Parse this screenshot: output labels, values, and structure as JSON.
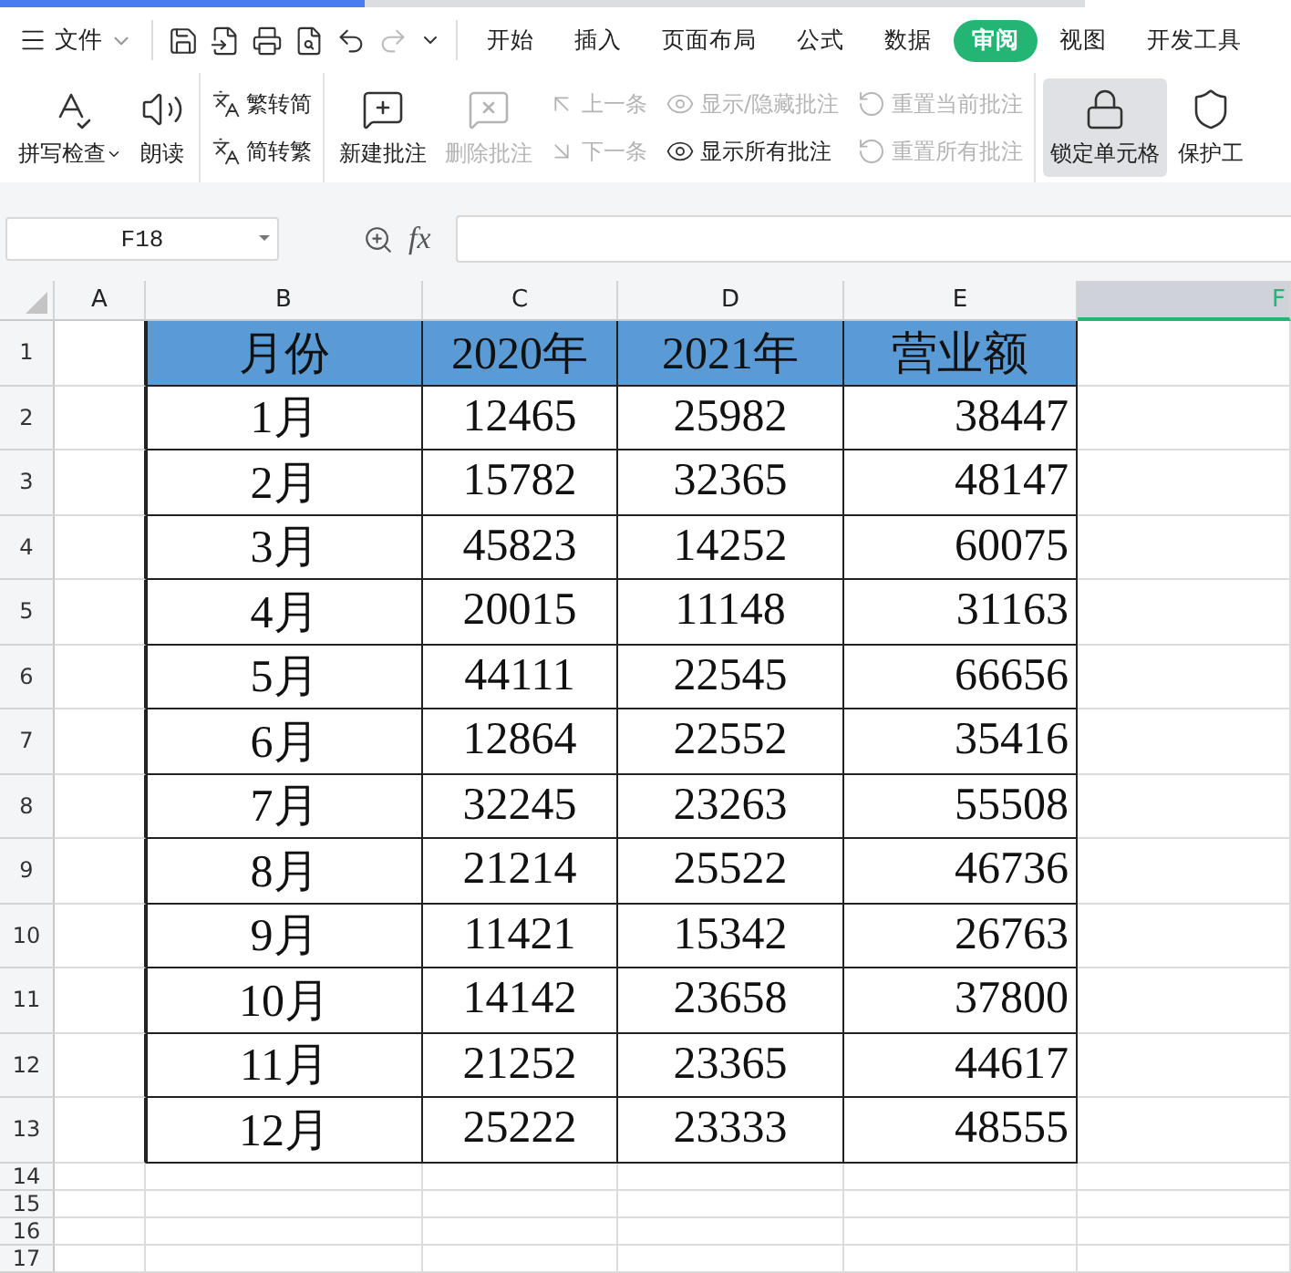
{
  "menu_bar": {
    "file_label": "文件",
    "tabs": [
      {
        "label": "开始",
        "selected": false
      },
      {
        "label": "插入",
        "selected": false
      },
      {
        "label": "页面布局",
        "selected": false
      },
      {
        "label": "公式",
        "selected": false
      },
      {
        "label": "数据",
        "selected": false
      },
      {
        "label": "审阅",
        "selected": true
      },
      {
        "label": "视图",
        "selected": false
      },
      {
        "label": "开发工具",
        "selected": false
      }
    ]
  },
  "ribbon": {
    "groups": [
      {
        "items": [
          {
            "kind": "large",
            "label": "拼写检查",
            "dropdown": true,
            "disabled": false,
            "highlighted": false
          },
          {
            "kind": "large",
            "label": "朗读",
            "disabled": false,
            "highlighted": false
          }
        ]
      },
      {
        "items": [
          {
            "kind": "small",
            "label": "繁转简",
            "disabled": false,
            "highlighted": false
          },
          {
            "kind": "small",
            "label": "简转繁",
            "disabled": false,
            "highlighted": false
          }
        ]
      },
      {
        "items": [
          {
            "kind": "large",
            "label": "新建批注",
            "disabled": false,
            "highlighted": false
          },
          {
            "kind": "large",
            "label": "删除批注",
            "disabled": true,
            "highlighted": false
          },
          {
            "kind": "small",
            "label": "上一条",
            "disabled": true,
            "highlighted": false
          },
          {
            "kind": "small",
            "label": "下一条",
            "disabled": true,
            "highlighted": false
          },
          {
            "kind": "small",
            "label": "显示/隐藏批注",
            "disabled": true,
            "highlighted": false
          },
          {
            "kind": "small",
            "label": "显示所有批注",
            "disabled": false,
            "highlighted": false
          },
          {
            "kind": "small",
            "label": "重置当前批注",
            "disabled": true,
            "highlighted": false
          },
          {
            "kind": "small",
            "label": "重置所有批注",
            "disabled": true,
            "highlighted": false
          }
        ]
      },
      {
        "items": [
          {
            "kind": "large",
            "label": "锁定单元格",
            "disabled": false,
            "highlighted": true
          },
          {
            "kind": "large",
            "label": "保护工",
            "disabled": false,
            "highlighted": false
          }
        ]
      }
    ]
  },
  "formula_bar": {
    "name_box": "F18",
    "function_label": "fx"
  },
  "sheet": {
    "columns": [
      {
        "label": "A",
        "selected": false
      },
      {
        "label": "B",
        "selected": false
      },
      {
        "label": "C",
        "selected": false
      },
      {
        "label": "D",
        "selected": false
      },
      {
        "label": "E",
        "selected": false
      },
      {
        "label": "F",
        "selected": true
      }
    ],
    "rows": [
      {
        "number": "1",
        "kind": "header",
        "cells": [
          "",
          "月份",
          "2020年",
          "2021年",
          "营业额"
        ]
      },
      {
        "number": "2",
        "kind": "data",
        "cells": [
          "",
          "1月",
          "12465",
          "25982",
          "38447"
        ]
      },
      {
        "number": "3",
        "kind": "data",
        "cells": [
          "",
          "2月",
          "15782",
          "32365",
          "48147"
        ]
      },
      {
        "number": "4",
        "kind": "data",
        "cells": [
          "",
          "3月",
          "45823",
          "14252",
          "60075"
        ]
      },
      {
        "number": "5",
        "kind": "data",
        "cells": [
          "",
          "4月",
          "20015",
          "11148",
          "31163"
        ]
      },
      {
        "number": "6",
        "kind": "data",
        "cells": [
          "",
          "5月",
          "44111",
          "22545",
          "66656"
        ]
      },
      {
        "number": "7",
        "kind": "data",
        "cells": [
          "",
          "6月",
          "12864",
          "22552",
          "35416"
        ]
      },
      {
        "number": "8",
        "kind": "data",
        "cells": [
          "",
          "7月",
          "32245",
          "23263",
          "55508"
        ]
      },
      {
        "number": "9",
        "kind": "data",
        "cells": [
          "",
          "8月",
          "21214",
          "25522",
          "46736"
        ]
      },
      {
        "number": "10",
        "kind": "data",
        "cells": [
          "",
          "9月",
          "11421",
          "15342",
          "26763"
        ]
      },
      {
        "number": "11",
        "kind": "data",
        "cells": [
          "",
          "10月",
          "14142",
          "23658",
          "37800"
        ]
      },
      {
        "number": "12",
        "kind": "data",
        "cells": [
          "",
          "11月",
          "21252",
          "23365",
          "44617"
        ]
      },
      {
        "number": "13",
        "kind": "data",
        "cells": [
          "",
          "12月",
          "25222",
          "23333",
          "48555"
        ]
      },
      {
        "number": "14",
        "kind": "empty",
        "cells": []
      },
      {
        "number": "15",
        "kind": "empty",
        "cells": []
      },
      {
        "number": "16",
        "kind": "empty",
        "cells": []
      },
      {
        "number": "17",
        "kind": "empty",
        "cells": []
      }
    ]
  }
}
